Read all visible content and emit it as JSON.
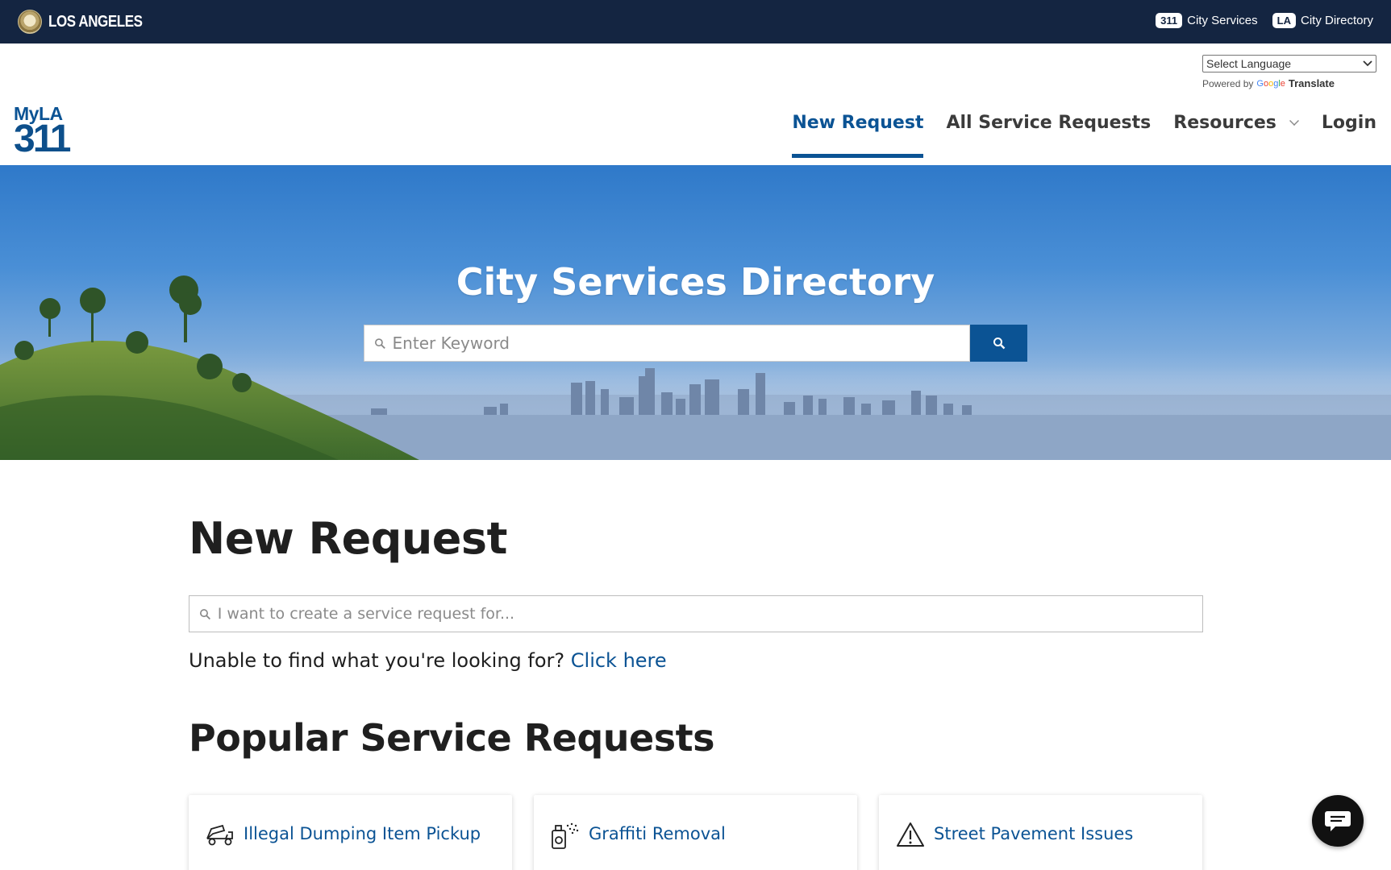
{
  "citybar": {
    "brand": "LOS ANGELES",
    "links": [
      {
        "badge": "311",
        "label": "City Services"
      },
      {
        "badge": "LA",
        "label": "City Directory"
      }
    ]
  },
  "translate": {
    "select_value": "Select Language",
    "powered_by": "Powered by",
    "google": "Google",
    "translate": "Translate"
  },
  "logo": {
    "top": "MyLA",
    "bottom": "311"
  },
  "nav": [
    {
      "label": "New Request",
      "active": true
    },
    {
      "label": "All Service Requests",
      "active": false
    },
    {
      "label": "Resources",
      "active": false
    },
    {
      "label": "Login",
      "active": false
    }
  ],
  "hero": {
    "title": "City Services Directory",
    "search_placeholder": "Enter Keyword"
  },
  "main": {
    "title": "New Request",
    "search_placeholder": "I want to create a service request for...",
    "notfound_text": "Unable to find what you're looking for?",
    "notfound_link": "Click here",
    "popular_title": "Popular Service Requests",
    "cards": [
      {
        "label": "Illegal Dumping Item Pickup",
        "icon": "truck-dumping-icon"
      },
      {
        "label": "Graffiti Removal",
        "icon": "spray-can-icon"
      },
      {
        "label": "Street Pavement Issues",
        "icon": "warning-triangle-icon"
      }
    ]
  },
  "colors": {
    "navy": "#142541",
    "brand_blue": "#0b5394"
  }
}
